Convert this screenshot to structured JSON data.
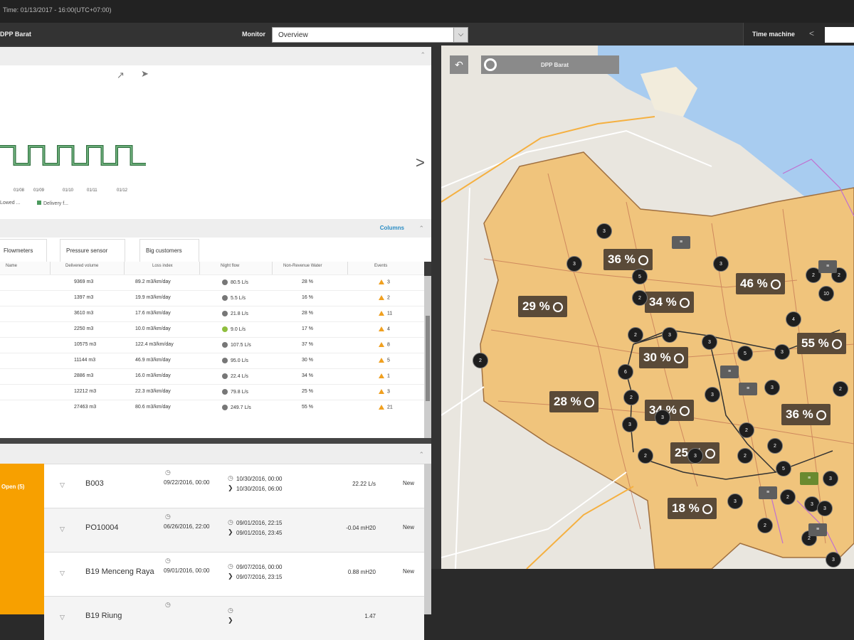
{
  "topbar": {
    "text": "Time: 01/13/2017 - 16:00(UTC+07:00)"
  },
  "toolbar": {
    "zone": "DPP Barat",
    "monitor_label": "Monitor",
    "monitor_value": "Overview",
    "timemachine_label": "Time machine",
    "timemachine_arrow": "<"
  },
  "chart_data": {
    "type": "line",
    "x": [
      "01/08",
      "01/09",
      "01/10",
      "01/11",
      "01/12"
    ],
    "series": [
      {
        "name": "Delivery f...",
        "values": [
          1,
          0,
          1,
          0,
          1,
          0,
          1,
          0,
          1,
          0
        ]
      }
    ],
    "title": "",
    "xlabel": "",
    "ylabel": "",
    "legend": [
      "Lowed ...",
      "Delivery f..."
    ]
  },
  "chart": {
    "xticks": [
      "01/08",
      "01/09",
      "01/10",
      "01/11",
      "01/12"
    ],
    "legend1": "Lowed ...",
    "legend2": "Delivery f...",
    "next": ">"
  },
  "columns_link": "Columns",
  "tabs": [
    "Flowmeters",
    "Pressure sensor",
    "Big customers"
  ],
  "table": {
    "headers": [
      "Name",
      "Delivered volume",
      "Loss index",
      "Night flow",
      "Non-Revenue Water",
      "Events"
    ],
    "rows": [
      {
        "vol": "9369 m3",
        "li": "89.2 m3/km/day",
        "nf": "80.5 L/s",
        "nrw": "28 %",
        "ev": "3",
        "green": false
      },
      {
        "vol": "1397 m3",
        "li": "19.9 m3/km/day",
        "nf": "5.5 L/s",
        "nrw": "16 %",
        "ev": "2",
        "green": false
      },
      {
        "vol": "3610 m3",
        "li": "17.6 m3/km/day",
        "nf": "21.8 L/s",
        "nrw": "28 %",
        "ev": "11",
        "green": false
      },
      {
        "vol": "2250 m3",
        "li": "10.0 m3/km/day",
        "nf": "9.0 L/s",
        "nrw": "17 %",
        "ev": "4",
        "green": true
      },
      {
        "vol": "10575 m3",
        "li": "122.4 m3/km/day",
        "nf": "107.5 L/s",
        "nrw": "37 %",
        "ev": "8",
        "green": false
      },
      {
        "vol": "11144 m3",
        "li": "46.9 m3/km/day",
        "nf": "95.0 L/s",
        "nrw": "30 %",
        "ev": "5",
        "green": false
      },
      {
        "vol": "2886 m3",
        "li": "16.0 m3/km/day",
        "nf": "22.4 L/s",
        "nrw": "34 %",
        "ev": "1",
        "green": false
      },
      {
        "vol": "12212 m3",
        "li": "22.3 m3/km/day",
        "nf": "79.8 L/s",
        "nrw": "25 %",
        "ev": "3",
        "green": false
      },
      {
        "vol": "27463 m3",
        "li": "80.6 m3/km/day",
        "nf": "249.7 L/s",
        "nrw": "55 %",
        "ev": "21",
        "green": false
      }
    ]
  },
  "alerts": {
    "badge": "Open (5)",
    "rows": [
      {
        "id": "B003",
        "date": "09/22/2016, 00:00",
        "t1": "10/30/2016, 00:00",
        "t2": "10/30/2016, 06:00",
        "val": "22.22 L/s",
        "status": "New"
      },
      {
        "id": "PO10004",
        "date": "06/26/2016, 22:00",
        "t1": "09/01/2016, 22:15",
        "t2": "09/01/2016, 23:45",
        "val": "-0.04 mH20",
        "status": "New"
      },
      {
        "id": "B19 Menceng Raya",
        "date": "09/01/2016, 00:00",
        "t1": "09/07/2016, 00:00",
        "t2": "09/07/2016, 23:15",
        "val": "0.88 mH20",
        "status": "New"
      },
      {
        "id": "B19 Riung",
        "date": "",
        "t1": "",
        "t2": "",
        "val": "1.47",
        "status": ""
      }
    ]
  },
  "map": {
    "zone_label": "DPP Barat",
    "percentages": [
      {
        "v": "36 %"
      },
      {
        "v": "46 %"
      },
      {
        "v": "29 %"
      },
      {
        "v": "34 %"
      },
      {
        "v": "30 %"
      },
      {
        "v": "55 %"
      },
      {
        "v": "28 %"
      },
      {
        "v": "34 %"
      },
      {
        "v": "36 %"
      },
      {
        "v": "25 %"
      },
      {
        "v": "18 %"
      }
    ],
    "nodes": [
      "3",
      "3",
      "5",
      "3",
      "2",
      "2",
      "2",
      "10",
      "4",
      "2",
      "3",
      "3",
      "3",
      "5",
      "6",
      "2",
      "3",
      "3",
      "3",
      "2",
      "2",
      "3",
      "2",
      "3",
      "2",
      "2",
      "5",
      "3",
      "3",
      "2",
      "3",
      "2",
      "3",
      "2",
      "3",
      "2"
    ]
  },
  "colors": {
    "accent": "#f7a000",
    "zone_fill": "#f0c47c",
    "link": "#2a8cc4",
    "water": "#a8ccf0"
  }
}
